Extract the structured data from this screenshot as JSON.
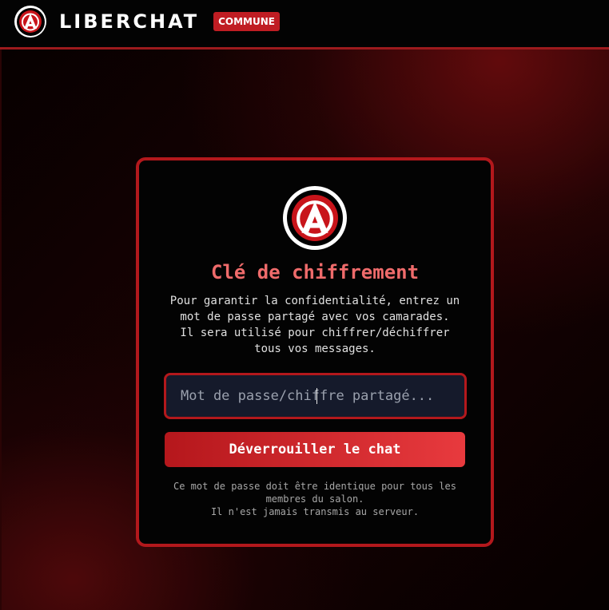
{
  "header": {
    "brand": "LIBERCHAT",
    "badge": "COMMUNE",
    "logo_icon": "anarchy-a-icon"
  },
  "card": {
    "logo_icon": "anarchy-a-icon",
    "title": "Clé de chiffrement",
    "description": "Pour garantir la confidentialité, entrez un\nmot de passe partagé avec vos camarades.\nIl sera utilisé pour chiffrer/déchiffrer\ntous vos messages.",
    "password": {
      "value": "",
      "placeholder": "Mot de passe/chiffre partagé..."
    },
    "unlock_label": "Déverrouiller le chat",
    "note": "Ce mot de passe doit être identique pour tous les\nmembres du salon.\nIl n'est jamais transmis au serveur."
  },
  "colors": {
    "accent": "#c01d23",
    "border": "#b3181c",
    "title": "#ef6b6b",
    "input_bg": "#151a2b"
  }
}
